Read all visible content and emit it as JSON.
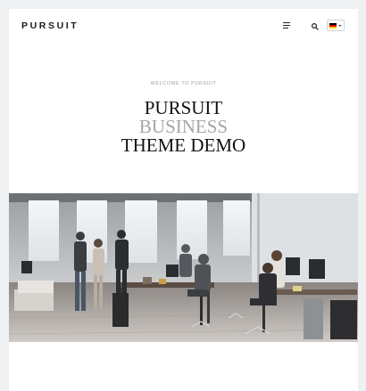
{
  "header": {
    "logo": "PURSUIT",
    "menu_icon": "hamburger-menu-icon",
    "search_icon": "search-icon",
    "language_flag": "germany-flag-icon"
  },
  "hero": {
    "welcome": "WELCOME TO PURSUIT",
    "title_line1": "PURSUIT",
    "title_line2": "BUSINESS",
    "title_line3": "THEME DEMO"
  },
  "colors": {
    "page_bg": "#eef0f2",
    "content_bg": "#ffffff",
    "title_dark": "#111111",
    "title_muted": "#a6a6a6",
    "welcome_text": "#9aa0a6"
  }
}
